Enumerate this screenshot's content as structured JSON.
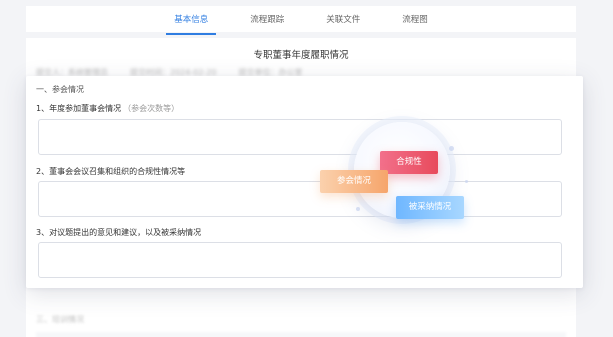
{
  "tabs": [
    {
      "label": "基本信息",
      "active": true
    },
    {
      "label": "流程跟踪",
      "active": false
    },
    {
      "label": "关联文件",
      "active": false
    },
    {
      "label": "流程图",
      "active": false
    }
  ],
  "form": {
    "title": "专职董事年度履职情况",
    "meta": {
      "applicant": "提交人：系统管理员",
      "submit_time": "提交时间：2024-02-20",
      "unit": "提交单位：办公室"
    },
    "section1": {
      "title": "一、参会情况",
      "q1_label": "1、年度参加董事会情况",
      "q1_hint": "（参会次数等）",
      "q2_label": "2、董事会会议召集和组织的合规性情况等",
      "q3_label": "3、对议题提出的意见和建议，以及被采纳情况"
    },
    "section3": {
      "title": "三、培训情况"
    }
  },
  "tags": {
    "compliance": "合规性",
    "attendance": "参会情况",
    "adoption": "被采纳情况"
  },
  "colors": {
    "accent": "#2f7de1",
    "tag_red": "#e84b5c",
    "tag_orange": "#f6a56b",
    "tag_blue": "#6fb7ff"
  }
}
